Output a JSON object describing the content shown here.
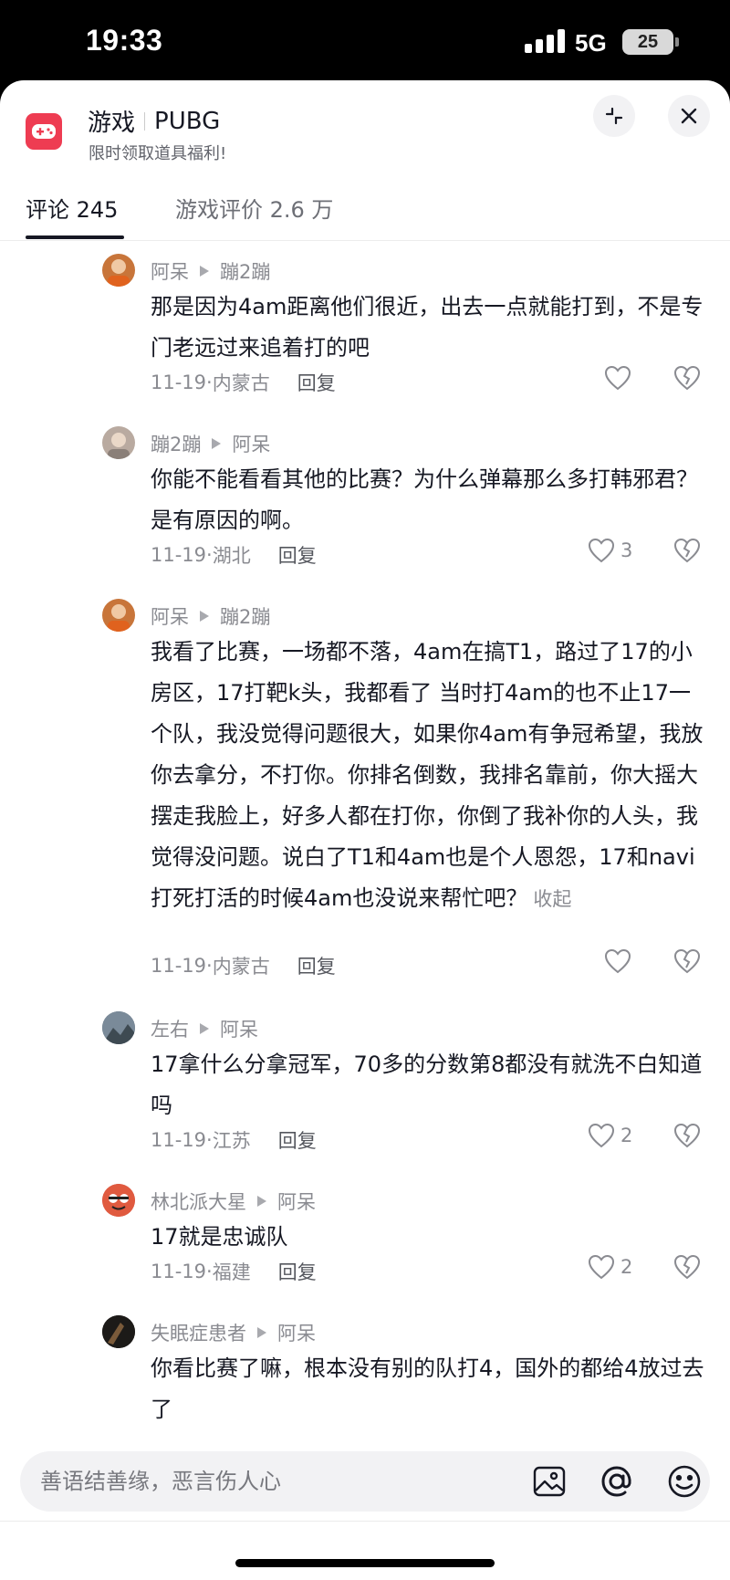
{
  "status_bar": {
    "time": "19:33",
    "network": "5G",
    "battery": "25"
  },
  "header": {
    "category": "游戏",
    "game_name": "PUBG",
    "subtitle": "限时领取道具福利!",
    "icons": {
      "game": "gamepad-icon",
      "minimize": "minimize-icon",
      "close": "close-icon"
    },
    "accent": "#ee3c52"
  },
  "tabs": [
    {
      "label": "评论 245",
      "active": true
    },
    {
      "label": "游戏评价 2.6 万",
      "active": false
    }
  ],
  "comments": [
    {
      "author": "阿呆",
      "reply_to": "蹦2蹦",
      "text": "那是因为4am距离他们很近，出去一点就能打到，不是专门老远过来追着打的吧",
      "date": "11-19",
      "location": "内蒙古",
      "reply_label": "回复",
      "likes": "",
      "avatar_color": "#c8753a"
    },
    {
      "author": "蹦2蹦",
      "reply_to": "阿呆",
      "text": "你能不能看看其他的比赛？为什么弹幕那么多打韩邪君？是有原因的啊。",
      "date": "11-19",
      "location": "湖北",
      "reply_label": "回复",
      "likes": "3",
      "avatar_color": "#b9aaa0"
    },
    {
      "author": "阿呆",
      "reply_to": "蹦2蹦",
      "text": "我看了比赛，一场都不落，4am在搞T1，路过了17的小房区，17打靶k头，我都看了 当时打4am的也不止17一个队，我没觉得问题很大，如果你4am有争冠希望，我放你去拿分，不打你。你排名倒数，我排名靠前，你大摇大摆走我脸上，好多人都在打你，你倒了我补你的人头，我觉得没问题。说白了T1和4am也是个人恩怨，17和navi打死打活的时候4am也没说来帮忙吧？",
      "collapse_label": "收起",
      "date": "11-19",
      "location": "内蒙古",
      "reply_label": "回复",
      "likes": "",
      "avatar_color": "#c8753a"
    },
    {
      "author": "左右",
      "reply_to": "阿呆",
      "text": "17拿什么分拿冠军，70多的分数第8都没有就洗不白知道吗",
      "date": "11-19",
      "location": "江苏",
      "reply_label": "回复",
      "likes": "2",
      "avatar_color": "#5a6a78"
    },
    {
      "author": "林北派大星",
      "reply_to": "阿呆",
      "text": "17就是忠诚队",
      "date": "11-19",
      "location": "福建",
      "reply_label": "回复",
      "likes": "2",
      "avatar_color": "#d9483b"
    },
    {
      "author": "失眠症患者",
      "reply_to": "阿呆",
      "text": "你看比赛了嘛，根本没有别的队打4，国外的都给4放过去了",
      "date": "",
      "location": "",
      "reply_label": "",
      "likes": "",
      "avatar_color": "#2a2624"
    }
  ],
  "input": {
    "placeholder": "善语结善缘，恶言伤人心",
    "icons": [
      "image-icon",
      "at-icon",
      "emoji-icon"
    ]
  }
}
